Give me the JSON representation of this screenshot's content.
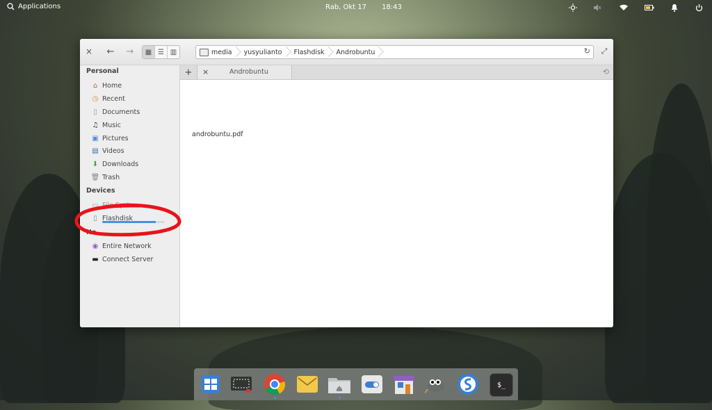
{
  "panel": {
    "applications_label": "Applications",
    "date": "Rab, Okt 17",
    "time": "18:43",
    "indicators": [
      "brightness-icon",
      "volume-muted-icon",
      "wifi-icon",
      "battery-icon",
      "notification-bell-icon",
      "power-icon"
    ]
  },
  "window": {
    "header": {
      "close_label": "×",
      "back_label": "←",
      "forward_label": "→",
      "view_modes": [
        "grid-view-icon",
        "list-view-icon",
        "column-view-icon"
      ],
      "active_view": "grid-view-icon",
      "breadcrumbs": [
        "media",
        "yusyulianto",
        "Flashdisk",
        "Androbuntu"
      ],
      "reload_label": "↻",
      "maximize_label": "⤢"
    },
    "sidebar": {
      "personal_title": "Personal",
      "personal_items": [
        {
          "label": "Home",
          "icon": "home-icon"
        },
        {
          "label": "Recent",
          "icon": "recent-icon"
        },
        {
          "label": "Documents",
          "icon": "documents-icon"
        },
        {
          "label": "Music",
          "icon": "music-icon"
        },
        {
          "label": "Pictures",
          "icon": "pictures-icon"
        },
        {
          "label": "Videos",
          "icon": "videos-icon"
        },
        {
          "label": "Downloads",
          "icon": "downloads-icon"
        },
        {
          "label": "Trash",
          "icon": "trash-icon"
        }
      ],
      "devices_title": "Devices",
      "device_items": [
        {
          "label": "File Syst",
          "icon": "drive-icon"
        },
        {
          "label": "Flashdisk",
          "icon": "usb-drive-icon",
          "usage_fraction": 0.85
        }
      ],
      "network_title": "Ne",
      "network_items": [
        {
          "label": "Entire Network",
          "icon": "network-icon"
        },
        {
          "label": "Connect Server",
          "icon": "server-icon"
        }
      ]
    },
    "tabs": {
      "add_label": "+",
      "items": [
        {
          "label": "Androbuntu",
          "close_label": "×"
        }
      ],
      "history_label": "⟲"
    },
    "files": [
      {
        "name": "androbuntu.pdf"
      }
    ]
  },
  "dock": {
    "apps": [
      {
        "name": "multitasking-view-icon",
        "bg": "#3b7fd1"
      },
      {
        "name": "screenshot-icon",
        "bg": "#333333"
      },
      {
        "name": "chrome-icon",
        "bg": "#ffffff"
      },
      {
        "name": "mail-icon",
        "bg": "#f2c94c"
      },
      {
        "name": "files-icon",
        "bg": "#bfc4c9"
      },
      {
        "name": "system-settings-icon",
        "bg": "#e8e8e8"
      },
      {
        "name": "appcenter-icon",
        "bg": "#8f5ec7"
      },
      {
        "name": "gimp-icon",
        "bg": "#6b6b6b"
      },
      {
        "name": "simplenote-icon",
        "bg": "#3b7fd1"
      },
      {
        "name": "terminal-icon",
        "bg": "#2b2b2b"
      }
    ],
    "terminal_prompt": "$_"
  }
}
